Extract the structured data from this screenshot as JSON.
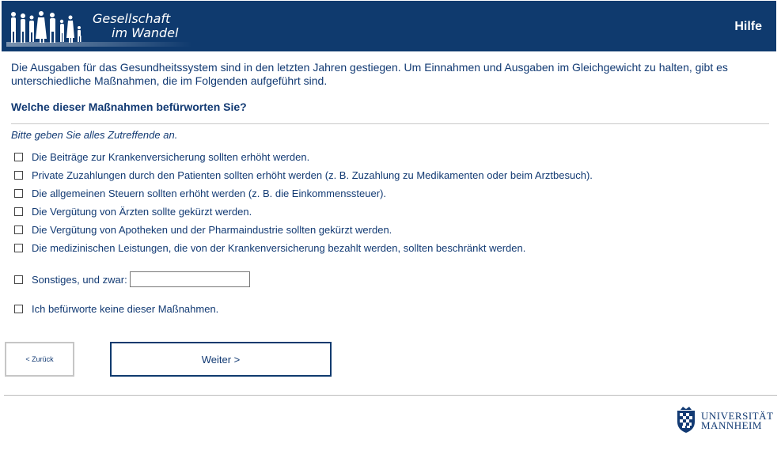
{
  "header": {
    "logo_line1": "Gesellschaft",
    "logo_line2": "im Wandel",
    "help_label": "Hilfe"
  },
  "intro_text": "Die Ausgaben für das Gesundheitssystem sind in den letzten Jahren gestiegen. Um Einnahmen und Ausgaben im Gleichgewicht zu halten, gibt es unterschiedliche Maßnahmen, die im Folgenden aufgeführt sind.",
  "question": "Welche dieser Maßnahmen befürworten Sie?",
  "instruction": "Bitte geben Sie alles Zutreffende an.",
  "options": [
    {
      "label": "Die Beiträge zur Krankenversicherung sollten erhöht werden.",
      "checked": false
    },
    {
      "label": "Private Zuzahlungen durch den Patienten sollten erhöht werden (z. B. Zuzahlung zu Medikamenten oder beim Arztbesuch).",
      "checked": false
    },
    {
      "label": "Die allgemeinen Steuern sollten erhöht werden (z. B. die Einkommenssteuer).",
      "checked": false
    },
    {
      "label": "Die Vergütung von Ärzten sollte gekürzt werden.",
      "checked": false
    },
    {
      "label": "Die Vergütung von Apotheken und der Pharmaindustrie sollten gekürzt werden.",
      "checked": false
    },
    {
      "label": "Die medizinischen Leistungen, die von der Krankenversicherung bezahlt werden, sollten beschränkt werden.",
      "checked": false
    }
  ],
  "other_option": {
    "label": "Sonstiges, und zwar:",
    "value": ""
  },
  "none_option": {
    "label": "Ich befürworte keine dieser Maßnahmen."
  },
  "buttons": {
    "back_label": "< Zurück",
    "next_label": "Weiter >"
  },
  "footer": {
    "uni_line1": "UNIVERSITÄT",
    "uni_line2": "MANNHEIM"
  },
  "colors": {
    "brand_navy": "#0f3a6e",
    "text_navy": "#123a73"
  }
}
